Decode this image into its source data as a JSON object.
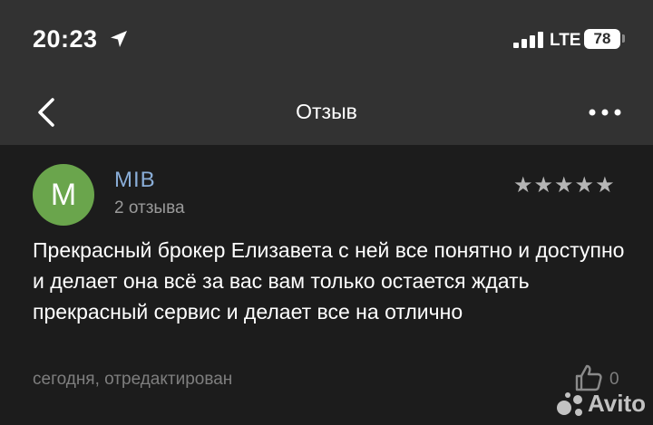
{
  "status_bar": {
    "time": "20:23",
    "network": "LTE",
    "battery": "78"
  },
  "nav": {
    "title": "Отзыв"
  },
  "review": {
    "avatar_letter": "M",
    "author": "MIB",
    "review_count": "2 отзыва",
    "rating": 5,
    "stars": "★★★★★",
    "text": "Прекрасный брокер Елизавета с ней все понятно и доступно и делает она всё за вас вам только остается ждать прекрасный сервис и делает все на отлично",
    "meta": "сегодня, отредактирован",
    "likes": "0"
  },
  "watermark": {
    "text": "Avito"
  },
  "colors": {
    "avatar": "#6aa54c",
    "author": "#8aaed8",
    "header_bg": "#323232",
    "page_bg": "#1c1c1c"
  }
}
